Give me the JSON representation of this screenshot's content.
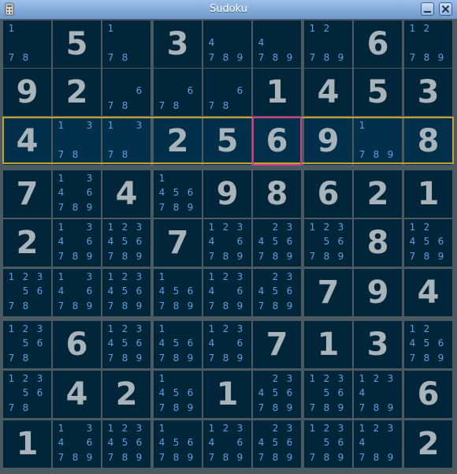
{
  "window": {
    "title": "Sudoku",
    "icons": [
      "app-icon",
      "minimize-icon",
      "close-icon"
    ]
  },
  "colors": {
    "cell_background": "#01263a",
    "given_digit": "#a8b4ba",
    "candidate_digit": "#5d9fe0",
    "grid_line": "#4a5a60",
    "row_highlight": "#c5a02b",
    "selected_cell": "#d43a86"
  },
  "board": {
    "highlighted_row": 3,
    "selected_cell": {
      "row": 3,
      "col": 6
    },
    "rows": [
      [
        {
          "c": [
            1,
            7,
            8
          ]
        },
        {
          "v": 5
        },
        {
          "c": [
            1,
            7,
            8
          ]
        },
        {
          "v": 3
        },
        {
          "c": [
            4,
            7,
            8,
            9
          ]
        },
        {
          "c": [
            4,
            7,
            8,
            9
          ]
        },
        {
          "c": [
            1,
            2,
            7,
            8,
            9
          ]
        },
        {
          "v": 6
        },
        {
          "c": [
            1,
            2,
            7,
            8,
            9
          ]
        }
      ],
      [
        {
          "v": 9
        },
        {
          "v": 2
        },
        {
          "c": [
            6,
            7,
            8
          ]
        },
        {
          "c": [
            6,
            7,
            8
          ]
        },
        {
          "c": [
            6,
            7,
            8
          ]
        },
        {
          "v": 1
        },
        {
          "v": 4
        },
        {
          "v": 5
        },
        {
          "v": 3
        }
      ],
      [
        {
          "v": 4
        },
        {
          "c": [
            1,
            3,
            7,
            8
          ]
        },
        {
          "c": [
            1,
            3,
            7,
            8
          ]
        },
        {
          "v": 2
        },
        {
          "v": 5
        },
        {
          "v": 6
        },
        {
          "v": 9
        },
        {
          "c": [
            1,
            7,
            8,
            9
          ]
        },
        {
          "v": 8
        }
      ],
      [
        {
          "v": 7
        },
        {
          "c": [
            1,
            3,
            4,
            6,
            7,
            8,
            9
          ]
        },
        {
          "v": 4
        },
        {
          "c": [
            1,
            4,
            5,
            6,
            7,
            8,
            9
          ]
        },
        {
          "v": 9
        },
        {
          "v": 8
        },
        {
          "v": 6
        },
        {
          "v": 2
        },
        {
          "v": 1
        }
      ],
      [
        {
          "v": 2
        },
        {
          "c": [
            1,
            3,
            4,
            6,
            7,
            8,
            9
          ]
        },
        {
          "c": [
            1,
            2,
            3,
            4,
            5,
            6,
            7,
            8,
            9
          ]
        },
        {
          "v": 7
        },
        {
          "c": [
            1,
            2,
            3,
            4,
            6,
            7,
            8,
            9
          ]
        },
        {
          "c": [
            2,
            3,
            4,
            5,
            6,
            7,
            8,
            9
          ]
        },
        {
          "c": [
            1,
            2,
            3,
            5,
            6,
            7,
            8,
            9
          ]
        },
        {
          "v": 8
        },
        {
          "c": [
            1,
            2,
            4,
            5,
            6,
            7,
            8,
            9
          ]
        }
      ],
      [
        {
          "c": [
            1,
            2,
            3,
            5,
            6,
            7,
            8
          ]
        },
        {
          "c": [
            1,
            3,
            4,
            6,
            7,
            8,
            9
          ]
        },
        {
          "c": [
            1,
            2,
            3,
            4,
            5,
            6,
            7,
            8,
            9
          ]
        },
        {
          "c": [
            1,
            4,
            5,
            6,
            7,
            8,
            9
          ]
        },
        {
          "c": [
            1,
            2,
            3,
            4,
            6,
            7,
            8,
            9
          ]
        },
        {
          "c": [
            2,
            3,
            4,
            5,
            6,
            7,
            8,
            9
          ]
        },
        {
          "v": 7
        },
        {
          "v": 9
        },
        {
          "v": 4
        }
      ],
      [
        {
          "c": [
            1,
            2,
            3,
            5,
            6,
            7,
            8
          ]
        },
        {
          "v": 6
        },
        {
          "c": [
            1,
            2,
            3,
            4,
            5,
            6,
            7,
            8,
            9
          ]
        },
        {
          "c": [
            1,
            4,
            5,
            6,
            7,
            8,
            9
          ]
        },
        {
          "c": [
            1,
            2,
            3,
            4,
            6,
            7,
            8,
            9
          ]
        },
        {
          "v": 7
        },
        {
          "v": 1
        },
        {
          "v": 3
        },
        {
          "c": [
            1,
            2,
            4,
            5,
            6,
            7,
            8,
            9
          ]
        }
      ],
      [
        {
          "c": [
            1,
            2,
            3,
            5,
            6,
            7,
            8
          ]
        },
        {
          "v": 4
        },
        {
          "v": 2
        },
        {
          "c": [
            1,
            4,
            5,
            6,
            7,
            8,
            9
          ]
        },
        {
          "v": 1
        },
        {
          "c": [
            2,
            3,
            4,
            5,
            6,
            7,
            8,
            9
          ]
        },
        {
          "c": [
            1,
            2,
            3,
            5,
            6,
            7,
            8,
            9
          ]
        },
        {
          "c": [
            1,
            2,
            3,
            4,
            7,
            8,
            9
          ]
        },
        {
          "v": 6
        }
      ],
      [
        {
          "v": 1
        },
        {
          "c": [
            1,
            3,
            4,
            6,
            7,
            8,
            9
          ]
        },
        {
          "c": [
            1,
            2,
            3,
            4,
            5,
            6,
            7,
            8,
            9
          ]
        },
        {
          "c": [
            1,
            4,
            5,
            6,
            7,
            8,
            9
          ]
        },
        {
          "c": [
            1,
            2,
            3,
            4,
            6,
            7,
            8,
            9
          ]
        },
        {
          "c": [
            2,
            3,
            4,
            5,
            6,
            7,
            8,
            9
          ]
        },
        {
          "c": [
            1,
            2,
            3,
            5,
            6,
            7,
            8,
            9
          ]
        },
        {
          "c": [
            1,
            2,
            3,
            4,
            7,
            8,
            9
          ]
        },
        {
          "v": 2
        }
      ]
    ]
  }
}
